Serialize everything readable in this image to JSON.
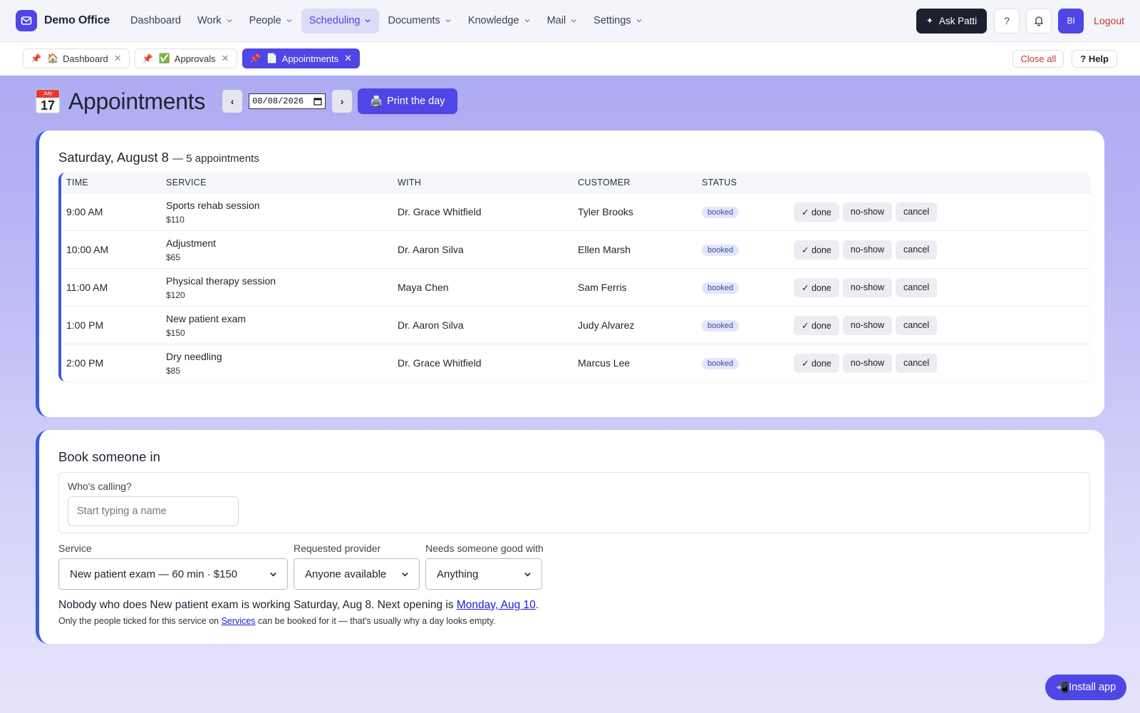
{
  "brand": {
    "name": "Demo Office"
  },
  "nav": {
    "items": [
      {
        "label": "Dashboard",
        "dropdown": false,
        "active": false
      },
      {
        "label": "Work",
        "dropdown": true,
        "active": false
      },
      {
        "label": "People",
        "dropdown": true,
        "active": false
      },
      {
        "label": "Scheduling",
        "dropdown": true,
        "active": true
      },
      {
        "label": "Documents",
        "dropdown": true,
        "active": false
      },
      {
        "label": "Knowledge",
        "dropdown": true,
        "active": false
      },
      {
        "label": "Mail",
        "dropdown": true,
        "active": false
      },
      {
        "label": "Settings",
        "dropdown": true,
        "active": false
      }
    ],
    "ask_label": "Ask Patti",
    "help_label": "?",
    "avatar_initials": "BI",
    "logout_label": "Logout"
  },
  "tabs": {
    "items": [
      {
        "icon": "🏠",
        "label": "Dashboard",
        "active": false
      },
      {
        "icon": "✅",
        "label": "Approvals",
        "active": false
      },
      {
        "icon": "📄",
        "label": "Appointments",
        "active": true
      }
    ],
    "close_all_label": "Close all",
    "help_label": "? Help"
  },
  "page": {
    "title": "Appointments",
    "calendar_month": "July",
    "calendar_day": "17",
    "prev_label": "‹",
    "next_label": "›",
    "date_value": "08/08/2026",
    "print_label": "Print the day"
  },
  "schedule": {
    "day_label": "Saturday, August 8",
    "count_label": "— 5 appointments",
    "columns": [
      "TIME",
      "SERVICE",
      "WITH",
      "CUSTOMER",
      "STATUS"
    ],
    "rows": [
      {
        "time": "9:00 AM",
        "service": "Sports rehab session",
        "price": "$110",
        "with": "Dr. Grace Whitfield",
        "customer": "Tyler Brooks",
        "status": "booked"
      },
      {
        "time": "10:00 AM",
        "service": "Adjustment",
        "price": "$65",
        "with": "Dr. Aaron Silva",
        "customer": "Ellen Marsh",
        "status": "booked"
      },
      {
        "time": "11:00 AM",
        "service": "Physical therapy session",
        "price": "$120",
        "with": "Maya Chen",
        "customer": "Sam Ferris",
        "status": "booked"
      },
      {
        "time": "1:00 PM",
        "service": "New patient exam",
        "price": "$150",
        "with": "Dr. Aaron Silva",
        "customer": "Judy Alvarez",
        "status": "booked"
      },
      {
        "time": "2:00 PM",
        "service": "Dry needling",
        "price": "$85",
        "with": "Dr. Grace Whitfield",
        "customer": "Marcus Lee",
        "status": "booked"
      }
    ],
    "actions": {
      "done": "✓ done",
      "noshow": "no-show",
      "cancel": "cancel"
    }
  },
  "booking": {
    "title": "Book someone in",
    "caller_label": "Who's calling?",
    "caller_placeholder": "Start typing a name",
    "service_label": "Service",
    "service_value": "New patient exam — 60 min · $150",
    "provider_label": "Requested provider",
    "provider_value": "Anyone available",
    "skill_label": "Needs someone good with",
    "skill_value": "Anything",
    "notice_text": "Nobody who does New patient exam is working Saturday, Aug 8. Next opening is ",
    "notice_link": "Monday, Aug 10",
    "notice_end": ".",
    "hint_before": "Only the people ticked for this service on ",
    "hint_link": "Services",
    "hint_after": " can be booked for it — that's usually why a day looks empty."
  },
  "install": {
    "label": "Install app"
  },
  "colors": {
    "accent": "#4f46e5",
    "card_border": "#3b5bdb",
    "danger": "#d0342c"
  }
}
